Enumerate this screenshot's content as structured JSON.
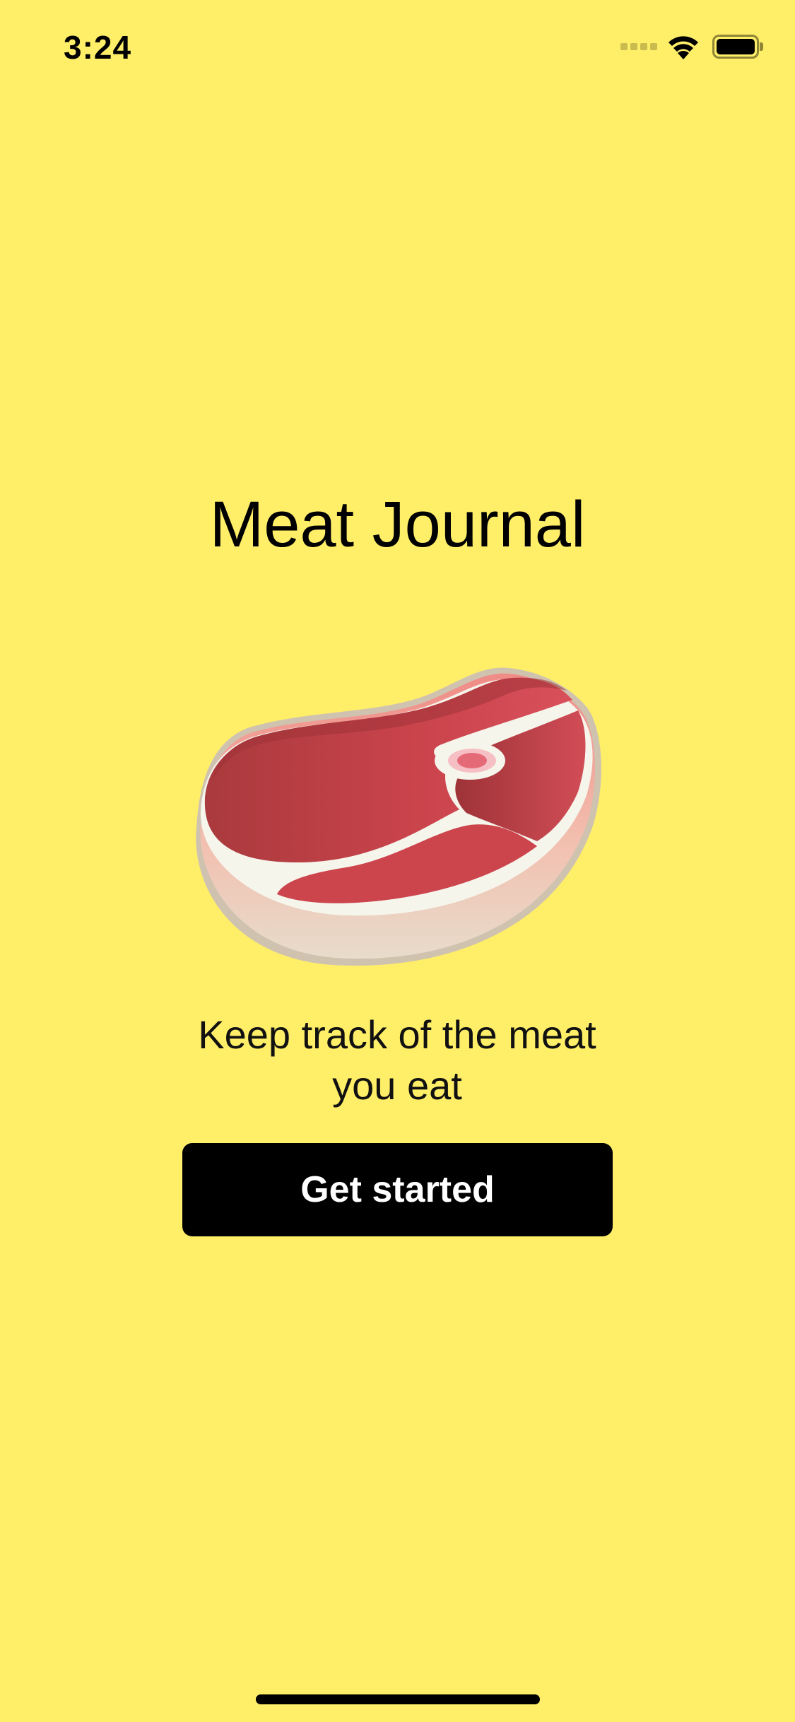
{
  "status_bar": {
    "time": "3:24",
    "icons": [
      "signal-icon",
      "wifi-icon",
      "battery-icon"
    ]
  },
  "onboarding": {
    "title": "Meat Journal",
    "illustration": "steak-icon",
    "tagline": "Keep track of the meat you eat",
    "cta_label": "Get started"
  },
  "colors": {
    "background": "#FFEE68",
    "button": "#000000",
    "button_text": "#FFFFFF",
    "meat": "#C9424A",
    "fat": "#F5F5EC"
  }
}
